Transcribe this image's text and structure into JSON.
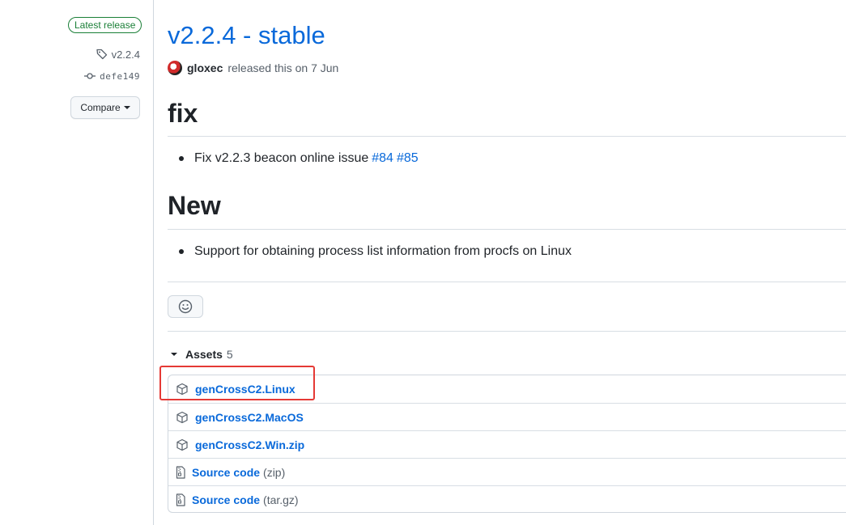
{
  "sidebar": {
    "badge": "Latest release",
    "tag": "v2.2.4",
    "commit": "defe149",
    "compare_label": "Compare"
  },
  "release": {
    "title": "v2.2.4 - stable",
    "author": "gloxec",
    "released_text": "released this on 7 Jun"
  },
  "notes": {
    "fix_heading": "fix",
    "fix_item": "Fix v2.2.3 beacon online issue",
    "fix_links": [
      "#84",
      "#85"
    ],
    "new_heading": "New",
    "new_item": "Support for obtaining process list information from procfs on Linux"
  },
  "assets": {
    "label": "Assets",
    "count": "5",
    "items": [
      {
        "name": "genCrossC2.Linux",
        "suffix": "",
        "icon": "package-icon"
      },
      {
        "name": "genCrossC2.MacOS",
        "suffix": "",
        "icon": "package-icon"
      },
      {
        "name": "genCrossC2.Win.zip",
        "suffix": "",
        "icon": "package-icon"
      },
      {
        "name": "Source code",
        "suffix": "(zip)",
        "icon": "file-zip-icon"
      },
      {
        "name": "Source code",
        "suffix": "(tar.gz)",
        "icon": "file-zip-icon"
      }
    ]
  },
  "colors": {
    "link": "#0969da",
    "badge_green": "#1a7f37",
    "highlight_red": "#e53935"
  }
}
